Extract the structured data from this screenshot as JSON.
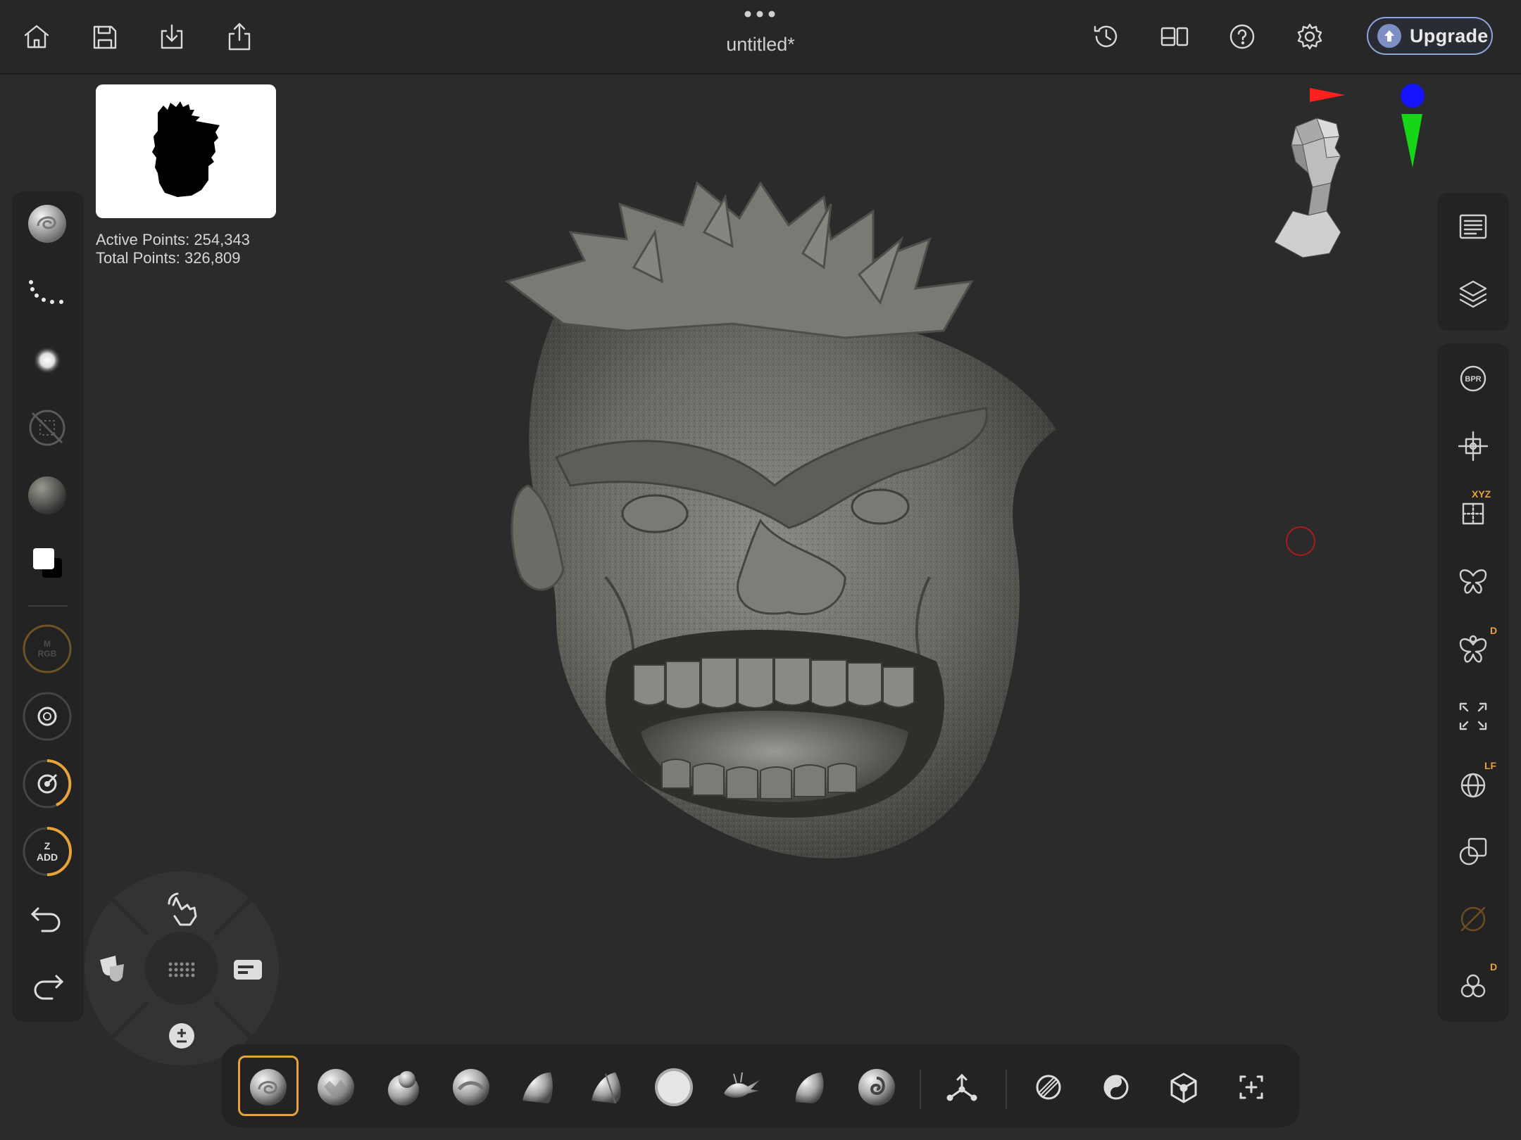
{
  "app": {
    "title": "untitled*",
    "upgrade_label": "Upgrade"
  },
  "top_left_actions": [
    {
      "name": "home-icon"
    },
    {
      "name": "save-icon"
    },
    {
      "name": "import-icon"
    },
    {
      "name": "share-icon"
    }
  ],
  "top_right_actions": [
    {
      "name": "history-icon"
    },
    {
      "name": "layout-icon"
    },
    {
      "name": "help-icon"
    },
    {
      "name": "settings-icon"
    }
  ],
  "stats": {
    "active_points": "Active Points: 254,343",
    "total_points": "Total Points: 326,809"
  },
  "left_toolbar": {
    "material_mode_label": "M\nRGB",
    "zadd_line1": "Z",
    "zadd_line2": "ADD"
  },
  "right_toolbar": {
    "bpr_label": "BPR",
    "xyz_badge": "XYZ",
    "dynamic_badge": "D",
    "lf_badge": "LF",
    "subtool_badge": "D"
  },
  "brush_tray": [
    "clay-buildup-brush",
    "clay-tubes-brush",
    "standard-brush",
    "move-brush",
    "trim-dynamic-brush",
    "hpolish-brush",
    "inflate-brush",
    "snakehook-brush",
    "smooth-brush",
    "dam-standard-brush"
  ],
  "colors": {
    "accent": "#e8a23a",
    "background": "#2b2b2b",
    "panel": "#232323",
    "axis_x": "#ff1f1f",
    "axis_y": "#17d617",
    "axis_z": "#1414ff"
  }
}
